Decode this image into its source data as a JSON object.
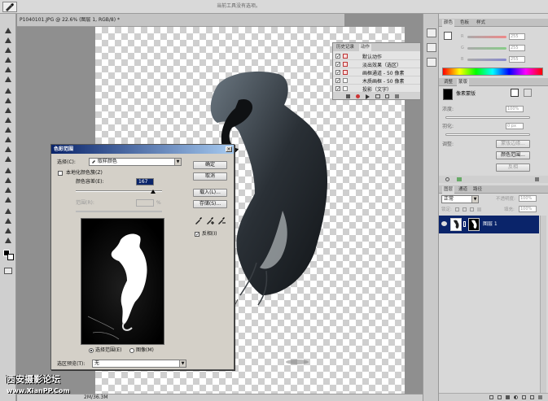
{
  "option_bar": {
    "hint": "当前工具没有选项。"
  },
  "document": {
    "tab_title": "P1040101.JPG @ 22.6% (图层 1, RGB/8) *",
    "status": "2M/36.3M"
  },
  "actions_panel": {
    "tabs": [
      "历史记录",
      "动作"
    ],
    "rows": [
      {
        "label": "默认动作",
        "checked": true
      },
      {
        "label": "淡出效果（选区）",
        "checked": true
      },
      {
        "label": "画框通道 - 50 像素",
        "checked": true
      },
      {
        "label": "木质画框 - 50 像素",
        "checked": true
      },
      {
        "label": "投影（文字）",
        "checked": true
      }
    ]
  },
  "color_panel": {
    "tabs": [
      "颜色",
      "色板",
      "样式"
    ],
    "channels": [
      {
        "label": "R",
        "value": "255",
        "color": "#cc4444"
      },
      {
        "label": "G",
        "value": "255",
        "color": "#44aa44"
      },
      {
        "label": "B",
        "value": "255",
        "color": "#4466cc"
      }
    ]
  },
  "masks_panel": {
    "tabs": [
      "调整",
      "蒙版"
    ],
    "mask_label": "像素蒙版",
    "density_label": "浓度:",
    "density_value": "100%",
    "feather_label": "羽化:",
    "feather_value": "0 px",
    "refine_label": "调整:",
    "buttons": [
      "蒙版边缘...",
      "颜色范围...",
      "反相"
    ]
  },
  "layers_panel": {
    "tabs": [
      "图层",
      "通道",
      "路径"
    ],
    "blend_mode": "正常",
    "opacity_label": "不透明度:",
    "opacity_value": "100%",
    "lock_label": "锁定:",
    "fill_label": "填充:",
    "fill_value": "100%",
    "layers": [
      {
        "name": "图层 1"
      }
    ]
  },
  "color_range_dialog": {
    "title": "色彩范围",
    "select_label": "选择(C):",
    "select_value": "取样颜色",
    "localized_label": "本地化颜色簇(Z)",
    "fuzziness_label": "颜色容差(E):",
    "fuzziness_value": "167",
    "range_label": "范围(R):",
    "range_unit": "%",
    "buttons": {
      "ok": "确定",
      "cancel": "取消",
      "load": "载入(L)...",
      "save": "存储(S)..."
    },
    "invert_label": "反相(I)",
    "invert_checked": true,
    "radio_selection": "选择范围(E)",
    "radio_image": "图像(M)",
    "preview_label": "选区预览(T):",
    "preview_value": "无"
  },
  "watermark": {
    "line1": "西安摄影论坛",
    "line2": "www.XianPP.Com"
  }
}
